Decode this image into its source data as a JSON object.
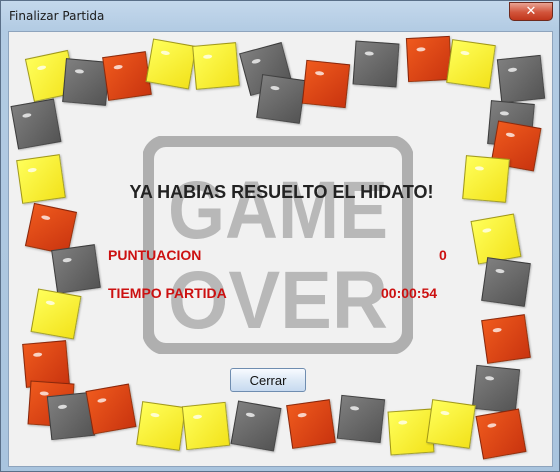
{
  "window": {
    "title": "Finalizar Partida",
    "close_glyph": "✕"
  },
  "background": {
    "emblem_line1": "GAME",
    "emblem_line2": "OVER"
  },
  "message": "YA HABIAS RESUELTO EL HIDATO!",
  "stats": {
    "score_label": "PUNTUACION",
    "score_value": "0",
    "time_label": "TIEMPO PARTIDA",
    "time_value": "00:00:54"
  },
  "buttons": {
    "close_label": "Cerrar"
  },
  "colors": {
    "stat_text": "#cc1111",
    "tile_yellow": "#f2e21b",
    "tile_orange": "#c9340f",
    "tile_gray": "#545454"
  }
}
